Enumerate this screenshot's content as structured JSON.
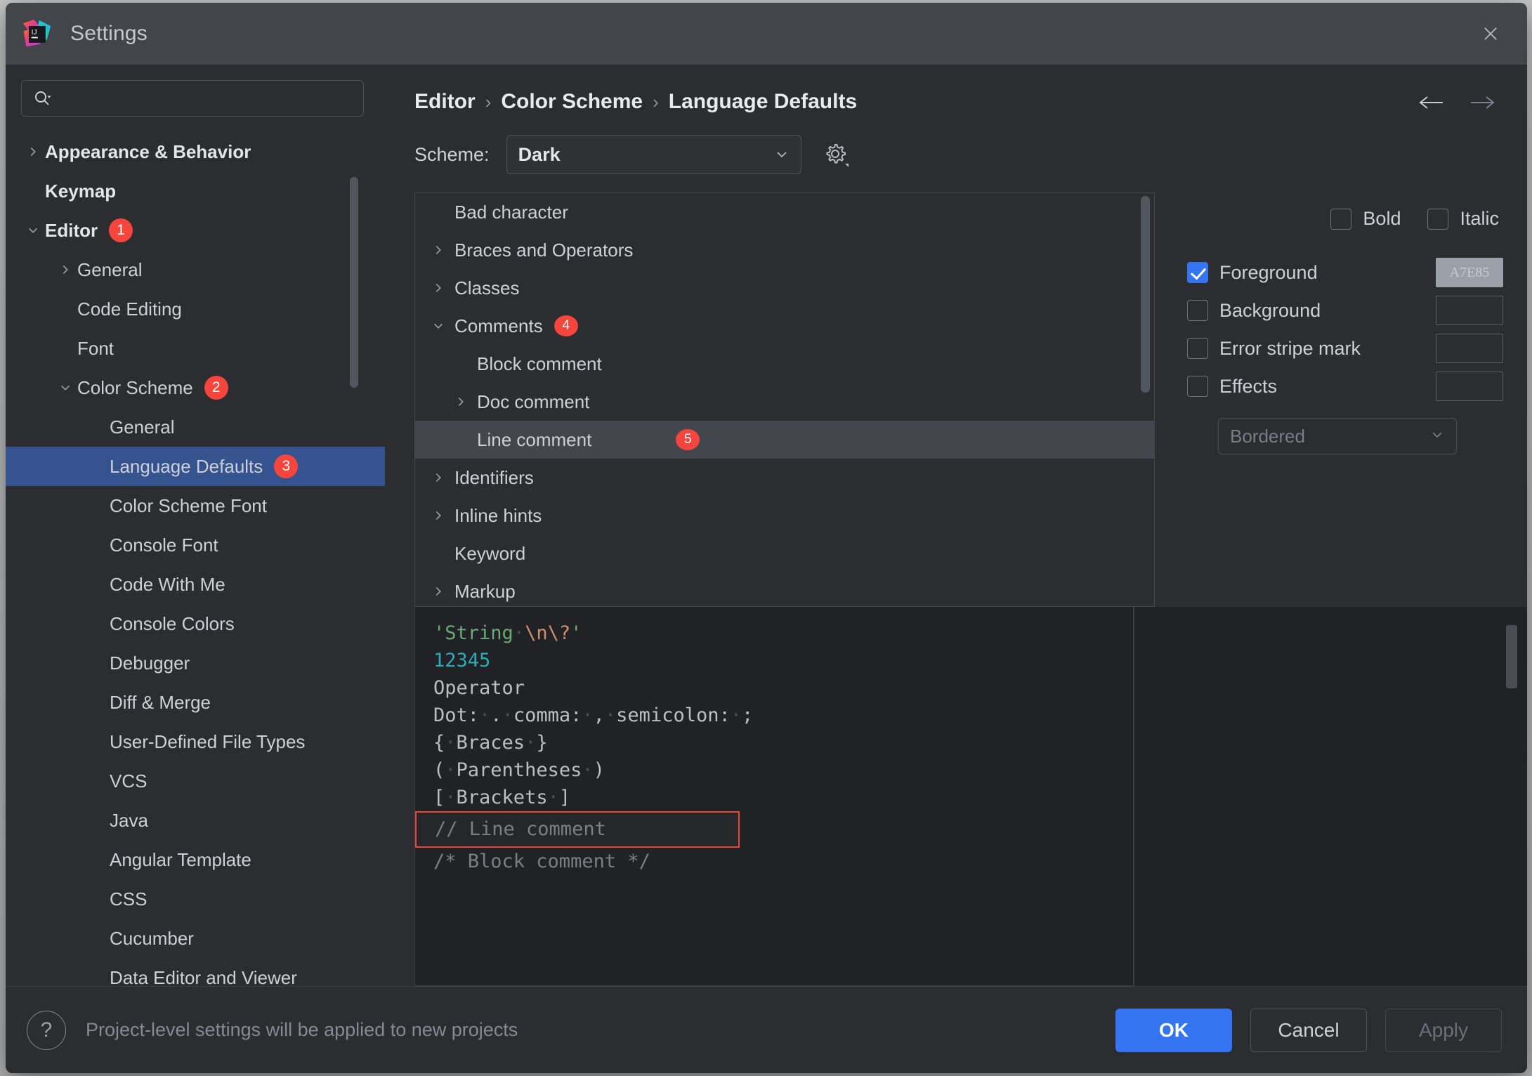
{
  "window": {
    "title": "Settings",
    "logo_icon": "intellij-idea-logo",
    "close_icon": "close-icon"
  },
  "search": {
    "value": "",
    "placeholder": "",
    "icon": "search-icon"
  },
  "sidebar": {
    "items": [
      {
        "label": "Appearance & Behavior",
        "indent": 0,
        "arrow": "chevron-right",
        "bold": true,
        "badge": null,
        "selected": false
      },
      {
        "label": "Keymap",
        "indent": 0,
        "arrow": "none",
        "bold": true,
        "badge": null,
        "selected": false
      },
      {
        "label": "Editor",
        "indent": 0,
        "arrow": "chevron-down",
        "bold": true,
        "badge": "1",
        "selected": false
      },
      {
        "label": "General",
        "indent": 1,
        "arrow": "chevron-right",
        "bold": false,
        "badge": null,
        "selected": false
      },
      {
        "label": "Code Editing",
        "indent": 1,
        "arrow": "none",
        "bold": false,
        "badge": null,
        "selected": false
      },
      {
        "label": "Font",
        "indent": 1,
        "arrow": "none",
        "bold": false,
        "badge": null,
        "selected": false
      },
      {
        "label": "Color Scheme",
        "indent": 1,
        "arrow": "chevron-down",
        "bold": false,
        "badge": "2",
        "selected": false
      },
      {
        "label": "General",
        "indent": 2,
        "arrow": "none",
        "bold": false,
        "badge": null,
        "selected": false
      },
      {
        "label": "Language Defaults",
        "indent": 2,
        "arrow": "none",
        "bold": false,
        "badge": "3",
        "selected": true
      },
      {
        "label": "Color Scheme Font",
        "indent": 2,
        "arrow": "none",
        "bold": false,
        "badge": null,
        "selected": false
      },
      {
        "label": "Console Font",
        "indent": 2,
        "arrow": "none",
        "bold": false,
        "badge": null,
        "selected": false
      },
      {
        "label": "Code With Me",
        "indent": 2,
        "arrow": "none",
        "bold": false,
        "badge": null,
        "selected": false
      },
      {
        "label": "Console Colors",
        "indent": 2,
        "arrow": "none",
        "bold": false,
        "badge": null,
        "selected": false
      },
      {
        "label": "Debugger",
        "indent": 2,
        "arrow": "none",
        "bold": false,
        "badge": null,
        "selected": false
      },
      {
        "label": "Diff & Merge",
        "indent": 2,
        "arrow": "none",
        "bold": false,
        "badge": null,
        "selected": false
      },
      {
        "label": "User-Defined File Types",
        "indent": 2,
        "arrow": "none",
        "bold": false,
        "badge": null,
        "selected": false
      },
      {
        "label": "VCS",
        "indent": 2,
        "arrow": "none",
        "bold": false,
        "badge": null,
        "selected": false
      },
      {
        "label": "Java",
        "indent": 2,
        "arrow": "none",
        "bold": false,
        "badge": null,
        "selected": false
      },
      {
        "label": "Angular Template",
        "indent": 2,
        "arrow": "none",
        "bold": false,
        "badge": null,
        "selected": false
      },
      {
        "label": "CSS",
        "indent": 2,
        "arrow": "none",
        "bold": false,
        "badge": null,
        "selected": false
      },
      {
        "label": "Cucumber",
        "indent": 2,
        "arrow": "none",
        "bold": false,
        "badge": null,
        "selected": false
      },
      {
        "label": "Data Editor and Viewer",
        "indent": 2,
        "arrow": "none",
        "bold": false,
        "badge": null,
        "selected": false
      }
    ]
  },
  "breadcrumb": {
    "items": [
      "Editor",
      "Color Scheme",
      "Language Defaults"
    ],
    "separator": "›",
    "back_icon": "arrow-left-icon",
    "forward_icon": "arrow-right-icon"
  },
  "scheme": {
    "label": "Scheme:",
    "value": "Dark",
    "chevron_icon": "chevron-down-icon",
    "gear_icon": "gear-icon"
  },
  "color_list": {
    "items": [
      {
        "label": "Bad character",
        "indent": 0,
        "arrow": "none",
        "badge": null,
        "selected": false
      },
      {
        "label": "Braces and Operators",
        "indent": 0,
        "arrow": "chevron-right",
        "badge": null,
        "selected": false
      },
      {
        "label": "Classes",
        "indent": 0,
        "arrow": "chevron-right",
        "badge": null,
        "selected": false
      },
      {
        "label": "Comments",
        "indent": 0,
        "arrow": "chevron-down",
        "badge": "4",
        "selected": false
      },
      {
        "label": "Block comment",
        "indent": 1,
        "arrow": "none",
        "badge": null,
        "selected": false
      },
      {
        "label": "Doc comment",
        "indent": 1,
        "arrow": "chevron-right",
        "badge": null,
        "selected": false
      },
      {
        "label": "Line comment",
        "indent": 1,
        "arrow": "none",
        "badge": "5",
        "selected": true
      },
      {
        "label": "Identifiers",
        "indent": 0,
        "arrow": "chevron-right",
        "badge": null,
        "selected": false
      },
      {
        "label": "Inline hints",
        "indent": 0,
        "arrow": "chevron-right",
        "badge": null,
        "selected": false
      },
      {
        "label": "Keyword",
        "indent": 0,
        "arrow": "none",
        "badge": null,
        "selected": false
      },
      {
        "label": "Markup",
        "indent": 0,
        "arrow": "chevron-right",
        "badge": null,
        "selected": false
      }
    ]
  },
  "options": {
    "bold": {
      "label": "Bold",
      "checked": false
    },
    "italic": {
      "label": "Italic",
      "checked": false
    },
    "rows": [
      {
        "label": "Foreground",
        "checked": true,
        "swatch_filled": true,
        "swatch_text": "A7E85"
      },
      {
        "label": "Background",
        "checked": false,
        "swatch_filled": false,
        "swatch_text": ""
      },
      {
        "label": "Error stripe mark",
        "checked": false,
        "swatch_filled": false,
        "swatch_text": ""
      },
      {
        "label": "Effects",
        "checked": false,
        "swatch_filled": false,
        "swatch_text": ""
      }
    ],
    "effect_type": {
      "value": "Bordered",
      "chevron_icon": "chevron-down-icon"
    }
  },
  "preview": {
    "lines": [
      {
        "id": "l1",
        "text": "'String \\n\\?'"
      },
      {
        "id": "l2",
        "text": "12345"
      },
      {
        "id": "l3",
        "text": "Operator"
      },
      {
        "id": "l4",
        "text": "Dot: . comma: , semicolon: ;"
      },
      {
        "id": "l5",
        "text": "{ Braces }"
      },
      {
        "id": "l6",
        "text": "( Parentheses )"
      },
      {
        "id": "l7",
        "text": "[ Brackets ]"
      },
      {
        "id": "l8",
        "text": "// Line comment"
      },
      {
        "id": "l9",
        "text": "/* Block comment */"
      }
    ],
    "parts": {
      "str_open": "'String",
      "str_escape": "\\n\\?",
      "str_close": "'",
      "number": "12345",
      "operator": "Operator",
      "punct_dot": "Dot:",
      "punct_dot_v": ".",
      "punct_comma": "comma:",
      "punct_comma_v": ",",
      "punct_semi": "semicolon:",
      "punct_semi_v": ";",
      "brace_l": "{",
      "brace_word": "Braces",
      "brace_r": "}",
      "paren_l": "(",
      "paren_word": "Parentheses",
      "paren_r": ")",
      "bracket_l": "[",
      "bracket_word": "Brackets",
      "bracket_r": "]",
      "line_comment": "// Line comment",
      "block_comment": "/* Block comment */"
    }
  },
  "footer": {
    "help_label": "?",
    "note": "Project-level settings will be applied to new projects",
    "ok": "OK",
    "cancel": "Cancel",
    "apply": "Apply"
  },
  "colors": {
    "accent_blue": "#3574f0",
    "selection_blue": "#35538f",
    "badge_red": "#f5453d",
    "highlight_red": "#f04438",
    "panel_bg": "#2b2d30",
    "titlebar_bg": "#43454a",
    "editor_bg": "#212225",
    "comment_gray": "#7a7e85",
    "string_green": "#6aab73",
    "number_cyan": "#2aacb8"
  }
}
